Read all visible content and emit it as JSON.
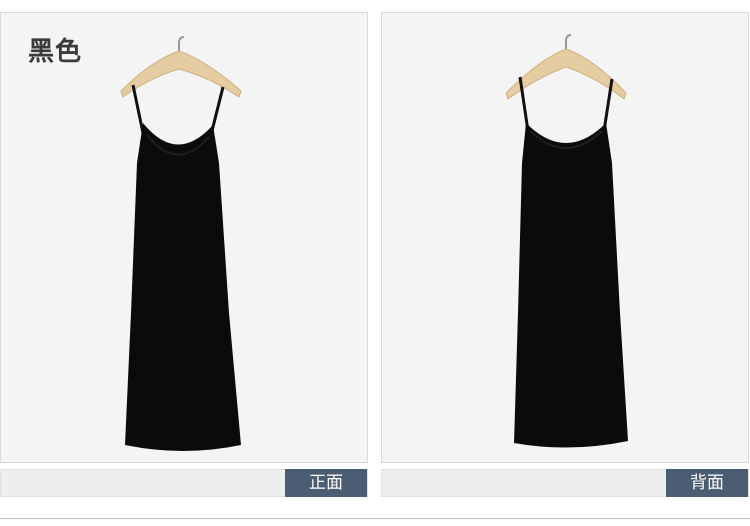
{
  "color_title": "黑色",
  "panels": [
    {
      "view_label": "正面"
    },
    {
      "view_label": "背面"
    }
  ],
  "colors": {
    "dress": "#0b0b0b",
    "hanger": "#e8cfa6",
    "label_bg": "#4b5d72",
    "panel_bg": "#f4f4f5"
  },
  "icons": {
    "hanger": "wooden-hanger",
    "garment": "black-slip-dress"
  }
}
